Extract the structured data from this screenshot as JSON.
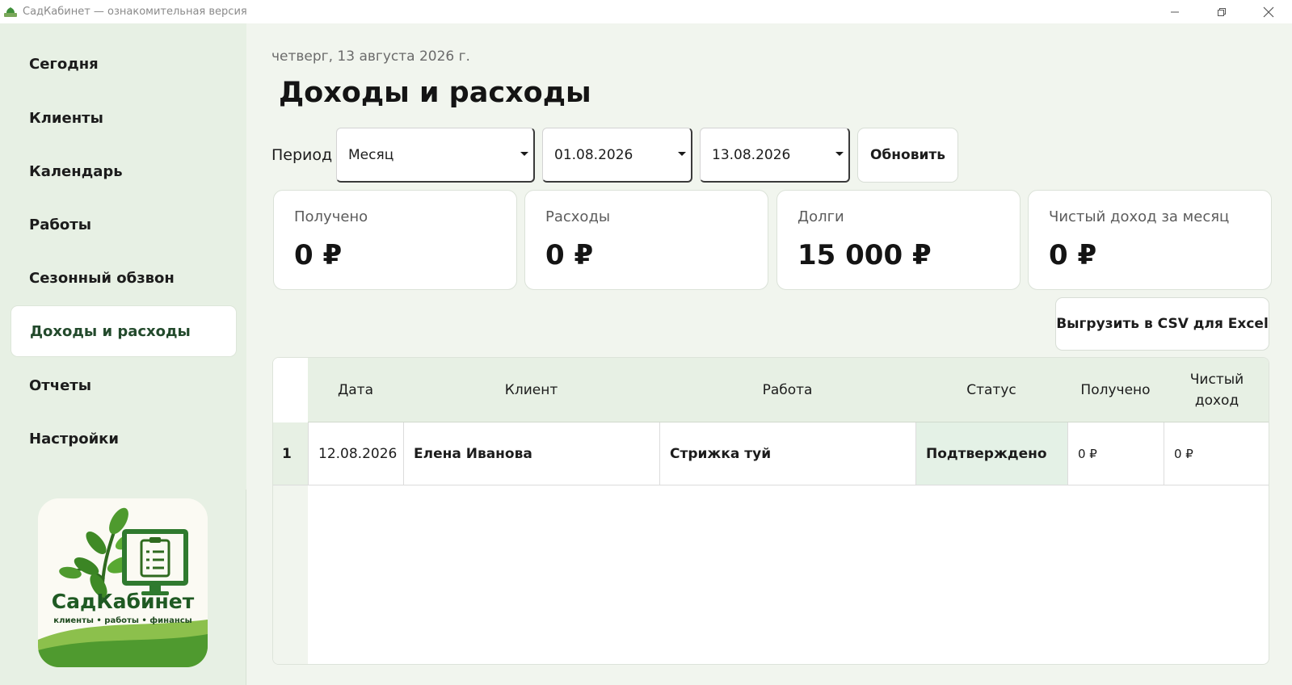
{
  "window": {
    "title": "СадКабинет — ознакомительная версия"
  },
  "sidebar": {
    "items": [
      {
        "label": "Сегодня"
      },
      {
        "label": "Клиенты"
      },
      {
        "label": "Календарь"
      },
      {
        "label": "Работы"
      },
      {
        "label": "Сезонный обзвон"
      },
      {
        "label": "Доходы и расходы",
        "active": true
      },
      {
        "label": "Отчеты"
      },
      {
        "label": "Настройки"
      }
    ],
    "logo": {
      "name": "СадКабинет",
      "tagline": "клиенты • работы • финансы"
    }
  },
  "header": {
    "date": "четверг, 13 августа 2026 г.",
    "title": "Доходы и расходы"
  },
  "filters": {
    "period_label": "Период",
    "period_value": "Месяц",
    "date_from": "01.08.2026",
    "date_to": "13.08.2026",
    "refresh_label": "Обновить"
  },
  "cards": [
    {
      "label": "Получено",
      "value": "0 ₽"
    },
    {
      "label": "Расходы",
      "value": "0 ₽"
    },
    {
      "label": "Долги",
      "value": "15 000 ₽"
    },
    {
      "label": "Чистый доход за месяц",
      "value": "0 ₽"
    }
  ],
  "export_label": "Выгрузить в CSV для Excel",
  "table": {
    "columns": [
      "Дата",
      "Клиент",
      "Работа",
      "Статус",
      "Получено",
      "Чистый доход"
    ],
    "rows": [
      {
        "num": "1",
        "date": "12.08.2026",
        "client": "Елена Иванова",
        "work": "Стрижка туй",
        "status": "Подтверждено",
        "received": "0 ₽",
        "net": "0 ₽"
      }
    ]
  },
  "colors": {
    "sidebar_bg": "#e7f0e4",
    "page_bg": "#f1f5ee",
    "status_bg": "#e4f1e6",
    "brand_green": "#2f7a2f"
  }
}
